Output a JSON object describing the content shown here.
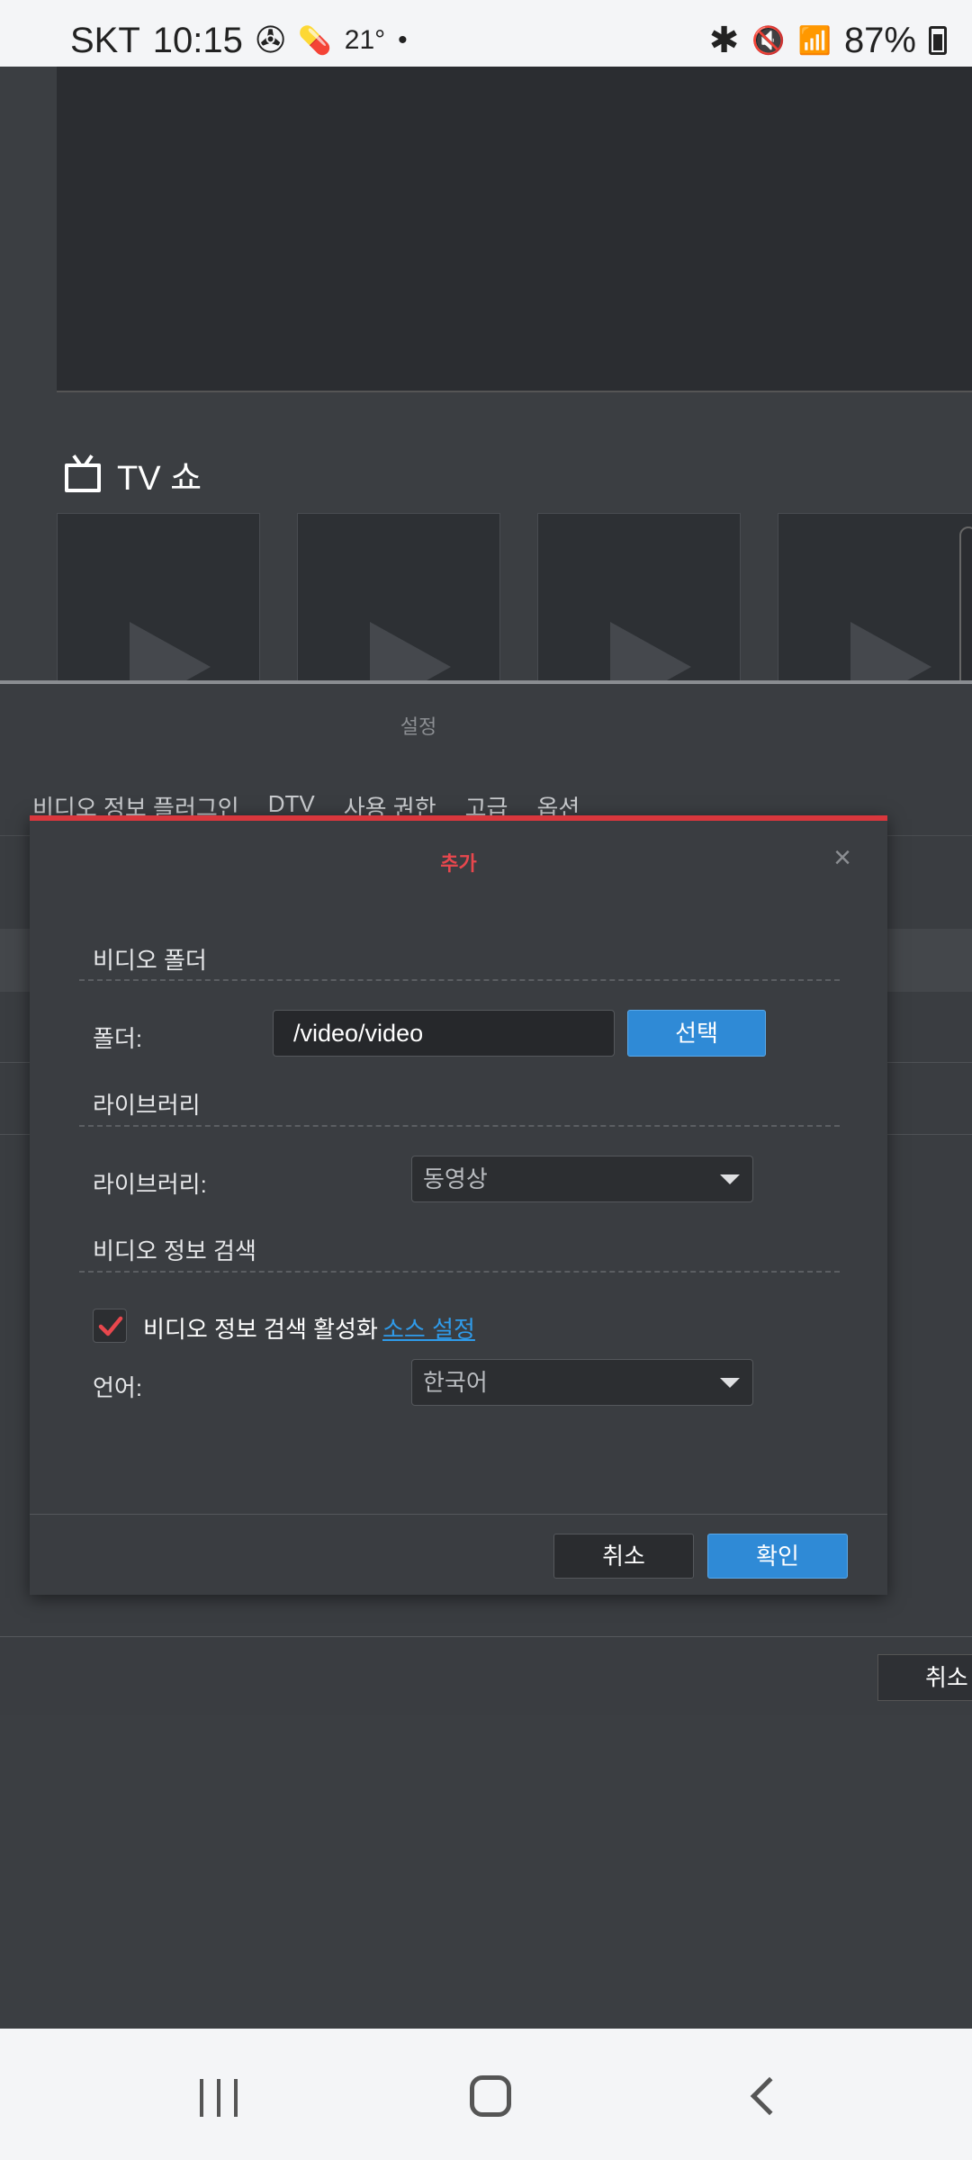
{
  "status_bar": {
    "carrier": "SKT",
    "time": "10:15",
    "temperature": "21°",
    "battery": "87%"
  },
  "background": {
    "section_title": "TV 쇼",
    "settings_title": "설정",
    "tabs": [
      "비디오 정보 플러그인",
      "DTV",
      "사용 권한",
      "고급",
      "옵션"
    ],
    "cancel_label": "취소"
  },
  "dialog": {
    "title": "추가",
    "close": "×",
    "video_folder_section": "비디오 폴더",
    "folder_label": "폴더:",
    "folder_value": "/video/video",
    "select_button": "선택",
    "library_section": "라이브러리",
    "library_label": "라이브러리:",
    "library_value": "동영상",
    "video_info_section": "비디오 정보 검색",
    "enable_video_info_label": "비디오 정보 검색 활성화",
    "enable_video_info_checked": true,
    "source_settings_link": "소스 설정",
    "language_label": "언어:",
    "language_value": "한국어",
    "cancel_button": "취소",
    "ok_button": "확인"
  },
  "colors": {
    "accent_red": "#d9373d",
    "primary_blue": "#2f8ad6",
    "link_blue": "#2f9bea"
  }
}
